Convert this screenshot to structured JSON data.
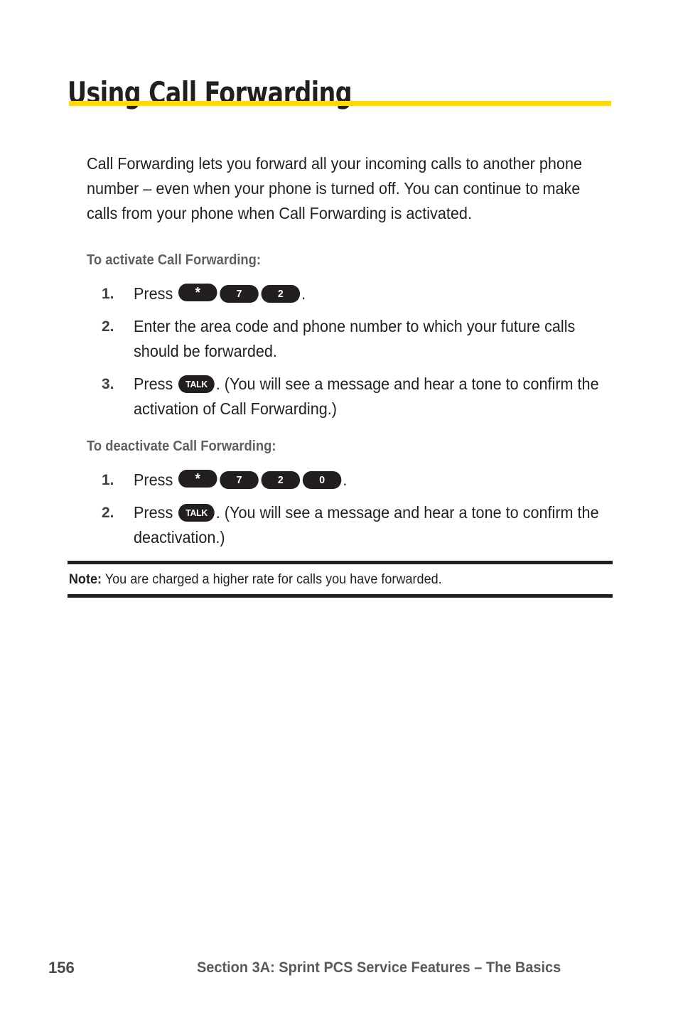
{
  "document": {
    "title": "Using Call Forwarding",
    "accent_color": "#ffd900",
    "text_color": "#231f20",
    "subhead_color": "#5f5f5f"
  },
  "intro": {
    "paragraph": "Call Forwarding lets you forward all your incoming calls to another phone number – even when your phone is turned off. You can continue to make calls from your phone when Call Forwarding is activated."
  },
  "activate": {
    "subhead": "To activate Call Forwarding:",
    "steps": [
      {
        "number": "1.",
        "prefix": "Press",
        "keys": [
          "*",
          "7",
          "2"
        ],
        "suffix": "."
      },
      {
        "number": "2.",
        "text": "Enter the area code and phone number to which your future calls should be forwarded."
      },
      {
        "number": "3.",
        "prefix": "Press",
        "keys": [
          "TALK"
        ],
        "suffix": ". (You will see a message and hear a tone to confirm the activation of Call Forwarding.)"
      }
    ]
  },
  "deactivate": {
    "subhead": "To deactivate Call Forwarding:",
    "steps": [
      {
        "number": "1.",
        "prefix": "Press",
        "keys": [
          "*",
          "7",
          "2",
          "0"
        ],
        "suffix": "."
      },
      {
        "number": "2.",
        "prefix": "Press",
        "keys": [
          "TALK"
        ],
        "suffix": ". (You will see a message and hear a tone to confirm the deactivation.)"
      }
    ]
  },
  "note": {
    "label": "Note:",
    "text": "You are charged a higher rate for calls you have forwarded."
  },
  "footer": {
    "page_number": "156",
    "section": "Section 3A: Sprint PCS Service Features – The Basics"
  }
}
